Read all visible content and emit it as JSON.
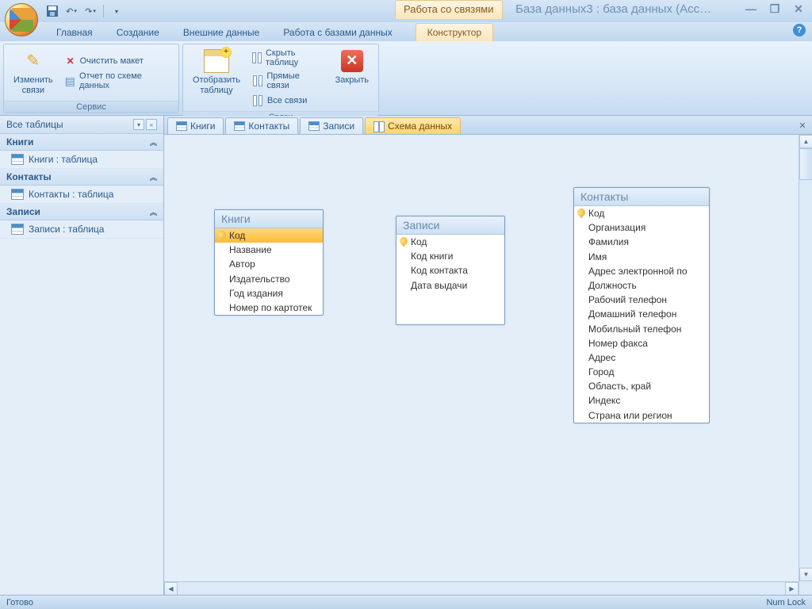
{
  "titlebar": {
    "context_tool_label": "Работа со связями",
    "app_title": "База данных3 : база данных (Acc…"
  },
  "ribbon_tabs": [
    "Главная",
    "Создание",
    "Внешние данные",
    "Работа с базами данных"
  ],
  "context_ribbon_tab": "Конструктор",
  "ribbon": {
    "group1": {
      "label": "Сервис",
      "edit_relations": "Изменить\nсвязи",
      "clear_layout": "Очистить макет",
      "report": "Отчет по схеме данных"
    },
    "group2": {
      "label": "Связи",
      "show_table": "Отобразить\nтаблицу",
      "hide_table": "Скрыть таблицу",
      "direct_relations": "Прямые связи",
      "all_relations": "Все связи",
      "close": "Закрыть"
    }
  },
  "navpane": {
    "header": "Все таблицы",
    "groups": [
      {
        "title": "Книги",
        "item": "Книги : таблица"
      },
      {
        "title": "Контакты",
        "item": "Контакты : таблица"
      },
      {
        "title": "Записи",
        "item": "Записи : таблица"
      }
    ]
  },
  "doc_tabs": [
    "Книги",
    "Контакты",
    "Записи"
  ],
  "doc_tab_active": "Схема данных",
  "tables": {
    "books": {
      "title": "Книги",
      "fields": [
        "Код",
        "Название",
        "Автор",
        "Издательство",
        "Год издания",
        "Номер по картотек"
      ]
    },
    "records": {
      "title": "Записи",
      "fields": [
        "Код",
        "Код книги",
        "Код контакта",
        "Дата выдачи"
      ]
    },
    "contacts": {
      "title": "Контакты",
      "fields": [
        "Код",
        "Организация",
        "Фамилия",
        "Имя",
        "Адрес электронной по",
        "Должность",
        "Рабочий телефон",
        "Домашний телефон",
        "Мобильный телефон",
        "Номер факса",
        "Адрес",
        "Город",
        "Область, край",
        "Индекс",
        "Страна или регион"
      ]
    }
  },
  "statusbar": {
    "left": "Готово",
    "right": "Num Lock"
  }
}
